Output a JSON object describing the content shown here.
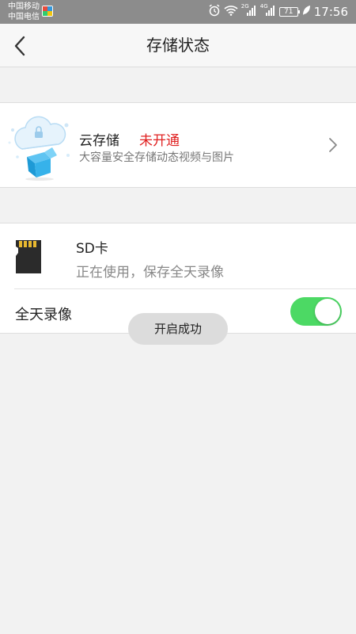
{
  "status_bar": {
    "carrier1": "中国移动",
    "carrier2": "中国电信",
    "network1": "2G",
    "network2": "4G",
    "battery": "71",
    "time": "17:56"
  },
  "header": {
    "title": "存储状态",
    "back_icon": "chevron-left-icon"
  },
  "cloud_storage": {
    "title": "云存储",
    "status": "未开通",
    "status_color": "#e02020",
    "description": "大容量安全存储动态视频与图片",
    "icon": "cloud-box-icon"
  },
  "sd_card": {
    "title": "SD卡",
    "description": "正在使用，保存全天录像",
    "icon": "sd-card-icon",
    "full_day_recording": {
      "label": "全天录像",
      "enabled": true,
      "toggle_color": "#4cd964"
    }
  },
  "toast": {
    "text": "开启成功"
  }
}
